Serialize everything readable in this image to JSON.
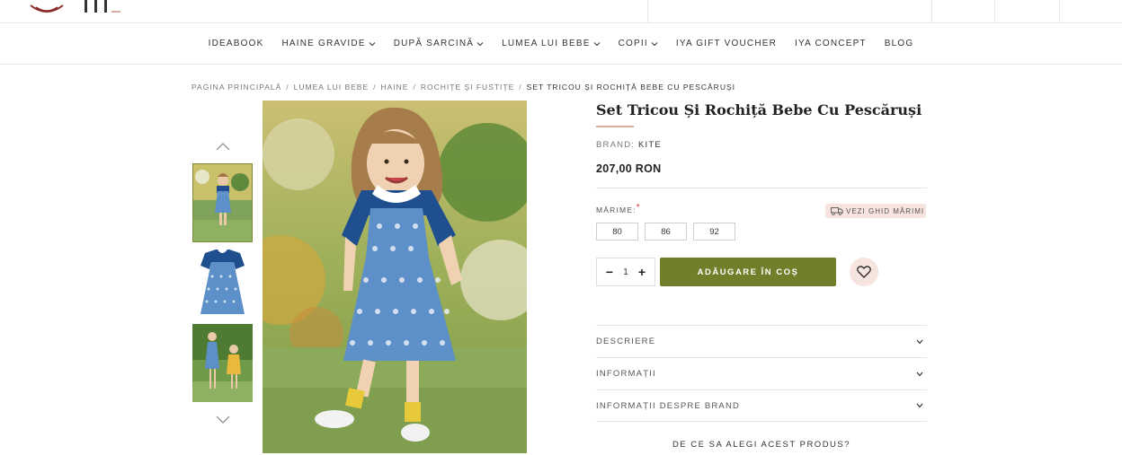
{
  "header": {
    "logo_text": "IYA"
  },
  "nav": [
    {
      "label": "IDEABOOK",
      "has_dropdown": false
    },
    {
      "label": "HAINE GRAVIDE",
      "has_dropdown": true
    },
    {
      "label": "DUPĂ SARCINĂ",
      "has_dropdown": true
    },
    {
      "label": "LUMEA LUI BEBE",
      "has_dropdown": true
    },
    {
      "label": "COPII",
      "has_dropdown": true
    },
    {
      "label": "IYA GIFT VOUCHER",
      "has_dropdown": false
    },
    {
      "label": "IYA CONCEPT",
      "has_dropdown": false
    },
    {
      "label": "BLOG",
      "has_dropdown": false
    }
  ],
  "breadcrumb": [
    "PAGINA PRINCIPALĂ",
    "LUMEA LUI BEBE",
    "HAINE",
    "ROCHIȚE ȘI FUSTIȚE",
    "SET TRICOU ȘI ROCHIȚĂ BEBE CU PESCĂRUȘI"
  ],
  "product": {
    "title": "Set Tricou Și Rochiță Bebe Cu Pescăruși",
    "brand_label": "BRAND:",
    "brand_value": "KITE",
    "price": "207,00 RON",
    "size_label": "MĂRIME:",
    "required_mark": "*",
    "size_guide": "VEZI GHID MĂRIMI",
    "sizes": [
      "80",
      "86",
      "92"
    ],
    "quantity": "1",
    "add_to_cart": "ADĂUGARE ÎN COȘ"
  },
  "accordion": [
    {
      "label": "DESCRIERE"
    },
    {
      "label": "INFORMAȚII"
    },
    {
      "label": "INFORMAȚII DESPRE BRAND"
    }
  ],
  "why_text": "DE CE SA ALEGI ACEST PRODUS?",
  "colors": {
    "accent_green": "#6f7f2a",
    "pink_soft": "#f7e4df",
    "title_underline": "#d9aaa0",
    "dress_blue": "#5d8fc9",
    "shirt_navy": "#1f4f8f"
  },
  "icons": {
    "wishlist": "heart-icon",
    "size_guide": "truck-icon",
    "gallery_prev": "chevron-up-icon",
    "gallery_next": "chevron-down-icon"
  }
}
